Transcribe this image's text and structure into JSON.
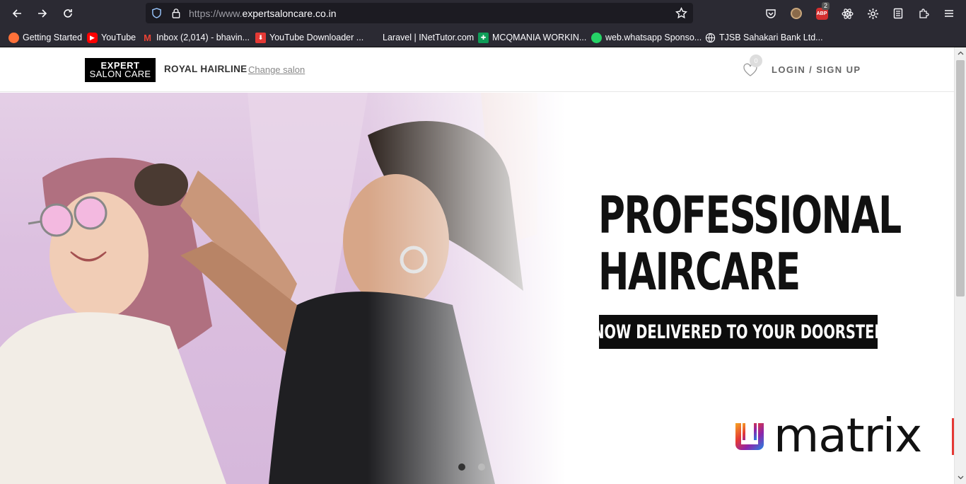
{
  "browser": {
    "url_prefix": "https://www.",
    "url_domain": "expertsaloncare.co.in",
    "abp_count": "2"
  },
  "bookmarks": [
    {
      "label": "Getting Started",
      "icon": "firefox-icon",
      "color": "#ff7139"
    },
    {
      "label": "YouTube",
      "icon": "youtube-icon",
      "color": "#ff0000"
    },
    {
      "label": "Inbox (2,014) - bhavin...",
      "icon": "gmail-icon",
      "color": "#ea4335"
    },
    {
      "label": "YouTube Downloader ...",
      "icon": "download-icon",
      "color": "#e53935"
    },
    {
      "label": "Laravel | INetTutor.com",
      "icon": "blank-icon",
      "color": "#2b2a33"
    },
    {
      "label": "MCQMANIA WORKIN...",
      "icon": "sheets-icon",
      "color": "#0f9d58"
    },
    {
      "label": "web.whatsapp Sponso...",
      "icon": "whatsapp-icon",
      "color": "#25d366"
    },
    {
      "label": "TJSB Sahakari Bank Ltd...",
      "icon": "globe-icon",
      "color": "#2b2a33"
    }
  ],
  "header": {
    "logo_line1": "EXPERT",
    "logo_line2": "SALON CARE",
    "salon_name": "ROYAL HAIRLINE",
    "change_salon": "Change salon",
    "wishlist_count": "0",
    "login": "LOGIN / SIGN UP"
  },
  "hero": {
    "headline_line1": "PROFESSIONAL",
    "headline_line2": "HAIRCARE",
    "strip": "NOW DELIVERED TO YOUR DOORSTEP",
    "brand": "matrix",
    "slides": 2,
    "active_slide": 1
  }
}
